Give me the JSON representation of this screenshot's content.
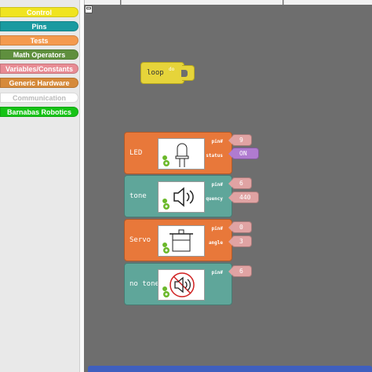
{
  "sidebar": {
    "categories": [
      {
        "label": "Control",
        "color": "#f0e420",
        "text_color": "#ffffff"
      },
      {
        "label": "Pins",
        "color": "#1a9aa0",
        "text_color": "#ffffff"
      },
      {
        "label": "Tests",
        "color": "#f49a4e",
        "text_color": "#ffffff"
      },
      {
        "label": "Math Operators",
        "color": "#5f8f3e",
        "text_color": "#ffffff"
      },
      {
        "label": "Variables/Constants",
        "color": "#e88c94",
        "text_color": "#ffffff"
      },
      {
        "label": "Generic Hardware",
        "color": "#d68a3a",
        "text_color": "#ffffff"
      },
      {
        "label": "Communication",
        "color": "#ffffff",
        "text_color": "#bbbbbb"
      },
      {
        "label": "Barnabas Robotics",
        "color": "#16c316",
        "text_color": "#ffffff"
      }
    ]
  },
  "workspace": {
    "loop_block": {
      "label": "loop",
      "do_label": "do",
      "color": "#e6d43a"
    },
    "blocks": [
      {
        "name": "LED",
        "color": "#e8783a",
        "icon": "led-icon",
        "params": [
          {
            "label": "pin#",
            "value": "9",
            "kind": "pin"
          },
          {
            "label": "status",
            "value": "ON",
            "kind": "on"
          }
        ]
      },
      {
        "name": "tone",
        "color": "#5fa69a",
        "icon": "speaker-icon",
        "params": [
          {
            "label": "pin#",
            "value": "6",
            "kind": "pin"
          },
          {
            "label": "quency",
            "value": "440",
            "kind": "pin"
          }
        ]
      },
      {
        "name": "Servo",
        "color": "#e8783a",
        "icon": "servo-icon",
        "params": [
          {
            "label": "pin#",
            "value": "0",
            "kind": "pin"
          },
          {
            "label": "angle",
            "value": "3",
            "kind": "pin"
          }
        ]
      },
      {
        "name": "no tone",
        "color": "#5fa69a",
        "icon": "speaker-muted-icon",
        "params": [
          {
            "label": "pin#",
            "value": "6",
            "kind": "pin"
          }
        ]
      }
    ]
  }
}
